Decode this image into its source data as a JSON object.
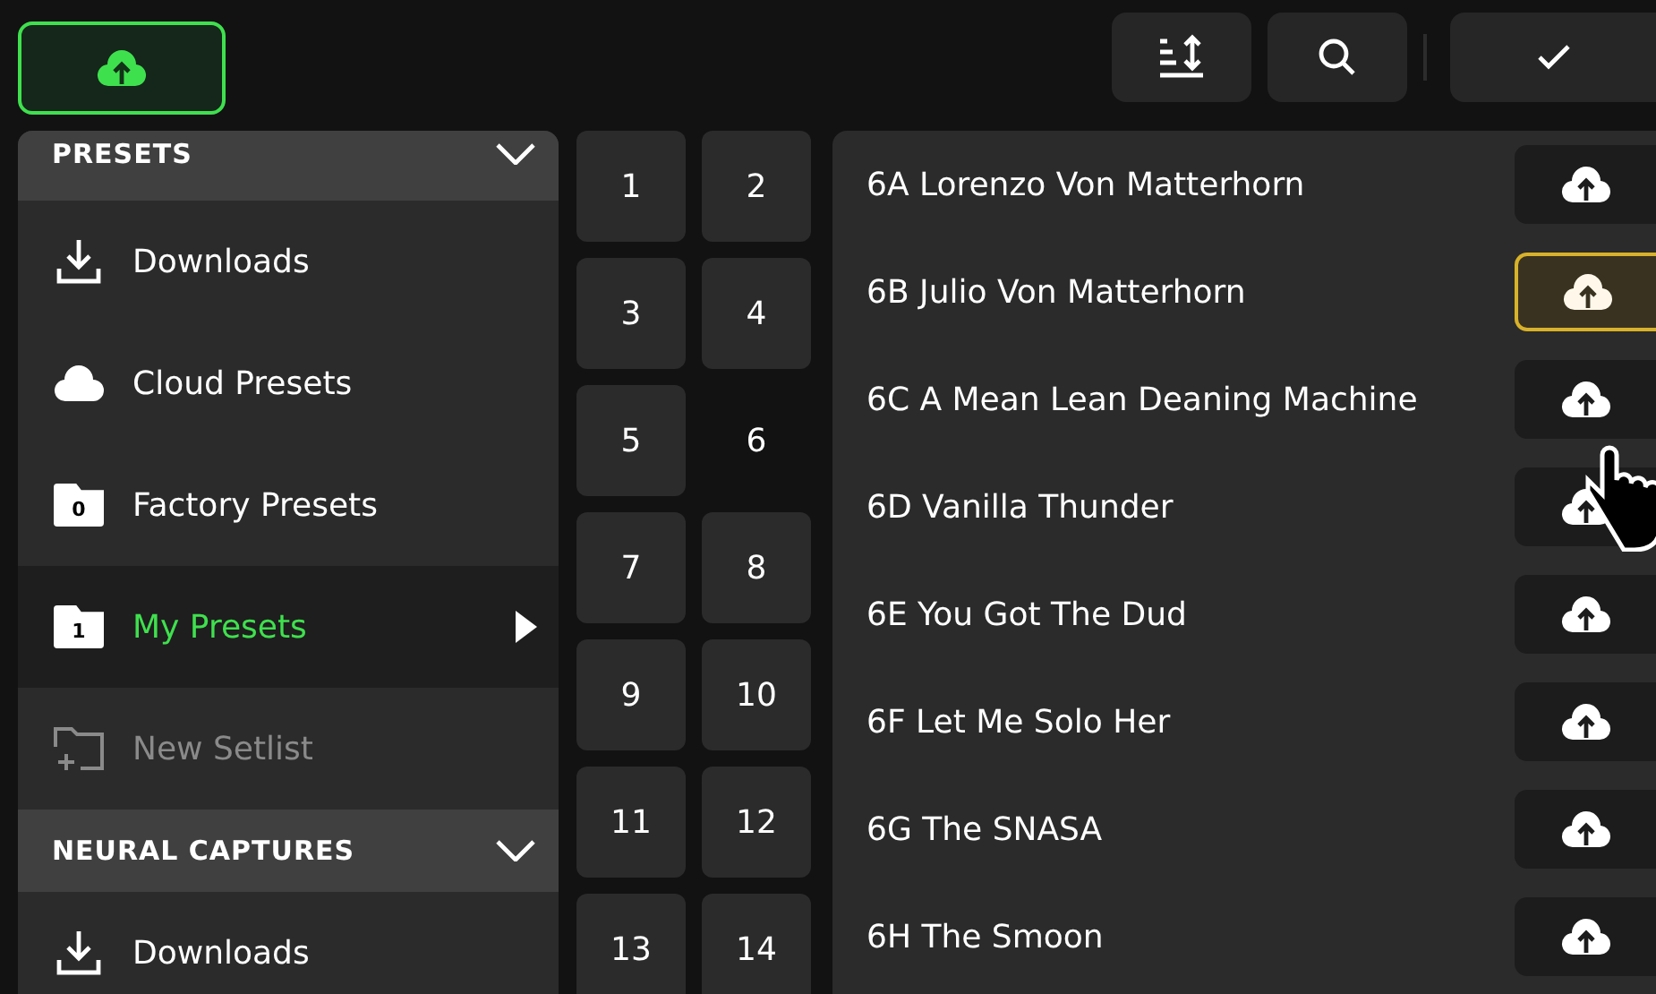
{
  "toolbar": {
    "upload_active": true
  },
  "sidebar": {
    "sections": [
      {
        "title": "PRESETS",
        "expanded": true,
        "items": [
          {
            "kind": "download",
            "label": "Downloads",
            "selected": false,
            "disabled": false
          },
          {
            "kind": "cloud",
            "label": "Cloud Presets",
            "selected": false,
            "disabled": false
          },
          {
            "kind": "folder",
            "badge": "0",
            "label": "Factory Presets",
            "selected": false,
            "disabled": false
          },
          {
            "kind": "folder",
            "badge": "1",
            "label": "My Presets",
            "selected": true,
            "disabled": false
          },
          {
            "kind": "new-folder",
            "label": "New Setlist",
            "selected": false,
            "disabled": true
          }
        ]
      },
      {
        "title": "NEURAL CAPTURES",
        "expanded": true,
        "items": [
          {
            "kind": "download",
            "label": "Downloads",
            "selected": false,
            "disabled": false
          }
        ]
      }
    ]
  },
  "banks": [
    {
      "label": "1",
      "selected": false
    },
    {
      "label": "2",
      "selected": false
    },
    {
      "label": "3",
      "selected": false
    },
    {
      "label": "4",
      "selected": false
    },
    {
      "label": "5",
      "selected": false
    },
    {
      "label": "6",
      "selected": true
    },
    {
      "label": "7",
      "selected": false
    },
    {
      "label": "8",
      "selected": false
    },
    {
      "label": "9",
      "selected": false
    },
    {
      "label": "10",
      "selected": false
    },
    {
      "label": "11",
      "selected": false
    },
    {
      "label": "12",
      "selected": false
    },
    {
      "label": "13",
      "selected": false
    },
    {
      "label": "14",
      "selected": false
    }
  ],
  "presets": [
    {
      "name": "6A Lorenzo Von Matterhorn",
      "upload_selected": false
    },
    {
      "name": "6B Julio Von Matterhorn",
      "upload_selected": true
    },
    {
      "name": "6C A Mean Lean Deaning Machine",
      "upload_selected": false
    },
    {
      "name": "6D Vanilla Thunder",
      "upload_selected": false
    },
    {
      "name": "6E You Got The Dud",
      "upload_selected": false
    },
    {
      "name": "6F Let Me Solo Her",
      "upload_selected": false
    },
    {
      "name": "6G The SNASA",
      "upload_selected": false
    },
    {
      "name": "6H The Smoon",
      "upload_selected": false
    }
  ]
}
